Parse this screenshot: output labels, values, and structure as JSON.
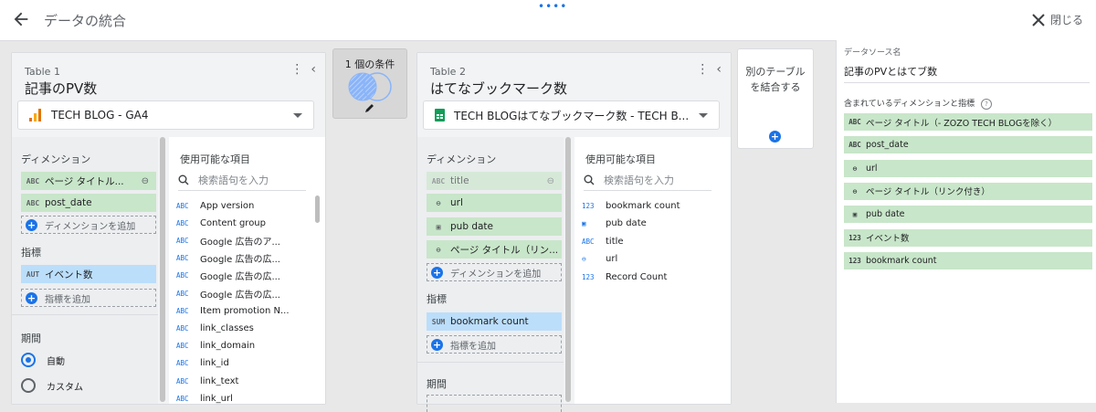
{
  "header": {
    "title": "データの統合",
    "close_label": "閉じる"
  },
  "table1": {
    "subtitle": "Table 1",
    "name": "記事のPV数",
    "source": "TECH BLOG - GA4",
    "dimensions_label": "ディメンション",
    "dimensions": [
      {
        "type": "ABC",
        "label": "ページ タイトル..."
      },
      {
        "type": "ABC",
        "label": "post_date"
      }
    ],
    "add_dimension": "ディメンションを追加",
    "metrics_label": "指標",
    "metrics": [
      {
        "type": "AUT",
        "label": "イベント数"
      }
    ],
    "add_metric": "指標を追加",
    "period_label": "期間",
    "period_auto": "自動",
    "period_custom": "カスタム",
    "available_label": "使用可能な項目",
    "search_placeholder": "検索語句を入力",
    "fields": [
      {
        "type": "ABC",
        "label": "App version"
      },
      {
        "type": "ABC",
        "label": "Content group"
      },
      {
        "type": "ABC",
        "label": "Google 広告のア..."
      },
      {
        "type": "ABC",
        "label": "Google 広告の広..."
      },
      {
        "type": "ABC",
        "label": "Google 広告の広..."
      },
      {
        "type": "ABC",
        "label": "Google 広告の広..."
      },
      {
        "type": "ABC",
        "label": "Item promotion N..."
      },
      {
        "type": "ABC",
        "label": "link_classes"
      },
      {
        "type": "ABC",
        "label": "link_domain"
      },
      {
        "type": "ABC",
        "label": "link_id"
      },
      {
        "type": "ABC",
        "label": "link_text"
      },
      {
        "type": "ABC",
        "label": "link_url"
      }
    ]
  },
  "condition": {
    "label": "1 個の条件"
  },
  "table2": {
    "subtitle": "Table 2",
    "name": "はてなブックマーク数",
    "source": "TECH BLOGはてなブックマーク数 - TECH B...",
    "dimensions_label": "ディメンション",
    "dimensions": [
      {
        "type": "ABC",
        "label": "title",
        "faded": true
      },
      {
        "type": "link",
        "label": "url"
      },
      {
        "type": "date",
        "label": "pub date"
      },
      {
        "type": "link",
        "label": "ページ タイトル（リン..."
      }
    ],
    "add_dimension": "ディメンションを追加",
    "metrics_label": "指標",
    "metrics": [
      {
        "type": "SUM",
        "label": "bookmark count"
      }
    ],
    "add_metric": "指標を追加",
    "period_label": "期間",
    "available_label": "使用可能な項目",
    "search_placeholder": "検索語句を入力",
    "fields": [
      {
        "type": "123",
        "label": "bookmark count"
      },
      {
        "type": "date",
        "label": "pub date"
      },
      {
        "type": "ABC",
        "label": "title"
      },
      {
        "type": "link",
        "label": "url"
      },
      {
        "type": "123",
        "label": "Record Count"
      }
    ]
  },
  "add_table": {
    "label": "別のテーブルを結合する"
  },
  "right_panel": {
    "source_name_label": "データソース名",
    "source_name": "記事のPVとはてブ数",
    "included_label": "含まれているディメンションと指標",
    "items": [
      {
        "type": "ABC",
        "label": "ページ タイトル（- ZOZO TECH BLOGを除く）"
      },
      {
        "type": "ABC",
        "label": "post_date"
      },
      {
        "type": "link",
        "label": "url"
      },
      {
        "type": "link",
        "label": "ページ タイトル（リンク付き）"
      },
      {
        "type": "date",
        "label": "pub date"
      },
      {
        "type": "123",
        "label": "イベント数"
      },
      {
        "type": "123",
        "label": "bookmark count"
      }
    ]
  }
}
